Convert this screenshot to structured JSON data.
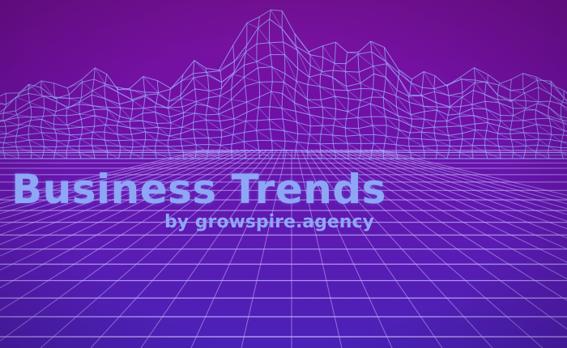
{
  "banner": {
    "title": "Business Trends",
    "subtitle": "by growspire.agency"
  },
  "colors": {
    "background_top": "#7a129c",
    "background_bottom": "#4a22b8",
    "grid_line": "#c9b6ff",
    "wireframe_line": "#9fb4ff",
    "text": "#8ea6f5"
  },
  "icons": {
    "background": "wireframe-mountain-grid-icon"
  }
}
